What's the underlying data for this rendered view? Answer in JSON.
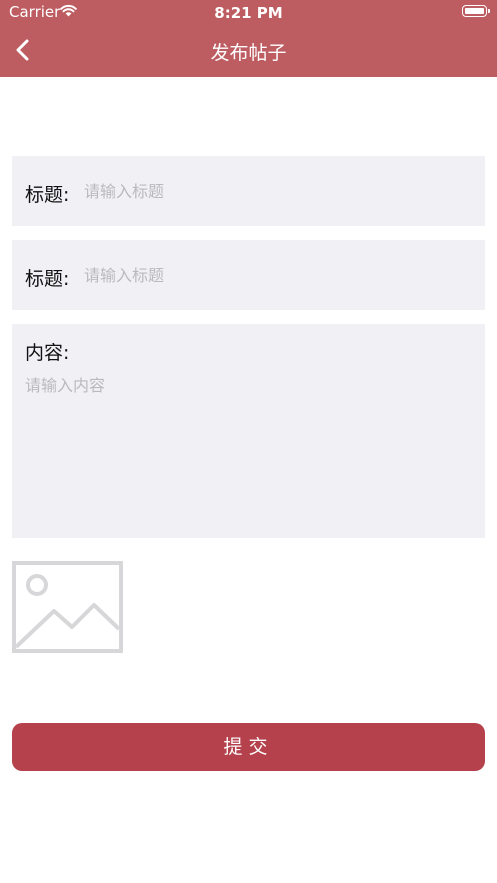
{
  "status_bar": {
    "carrier": "Carrier",
    "time": "8:21 PM"
  },
  "header": {
    "title": "发布帖子",
    "back_icon": "chevron-left-icon"
  },
  "form": {
    "field1": {
      "label": "标题:",
      "placeholder": "请输入标题",
      "value": ""
    },
    "field2": {
      "label": "标题:",
      "placeholder": "请输入标题",
      "value": ""
    },
    "content": {
      "label": "内容:",
      "placeholder": "请输入内容",
      "value": ""
    },
    "image_icon": "image-placeholder-icon",
    "submit_label": "提交"
  },
  "colors": {
    "header_bg": "#bd5d62",
    "field_bg": "#f1f1f5",
    "submit_bg": "#b4414b"
  }
}
